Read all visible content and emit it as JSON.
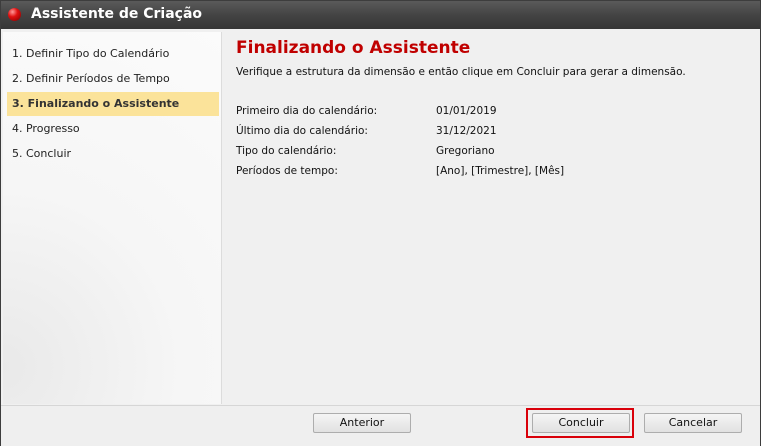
{
  "window": {
    "title": "Assistente de Criação"
  },
  "sidebar": {
    "steps": [
      {
        "label": "1. Definir Tipo do Calendário"
      },
      {
        "label": "2. Definir Períodos de Tempo"
      },
      {
        "label": "3. Finalizando o Assistente",
        "active": true
      },
      {
        "label": "4. Progresso"
      },
      {
        "label": "5. Concluir"
      }
    ]
  },
  "main": {
    "heading": "Finalizando o Assistente",
    "subtitle": "Verifique a estrutura da dimensão e então clique em Concluir para gerar a dimensão.",
    "summary": [
      {
        "label": "Primeiro dia do calendário:",
        "value": "01/01/2019"
      },
      {
        "label": "Último dia do calendário:",
        "value": "31/12/2021"
      },
      {
        "label": "Tipo do calendário:",
        "value": "Gregoriano"
      },
      {
        "label": "Períodos de tempo:",
        "value": "[Ano], [Trimestre], [Mês]"
      }
    ]
  },
  "footer": {
    "back_label": "Anterior",
    "finish_label": "Concluir",
    "cancel_label": "Cancelar"
  },
  "colors": {
    "heading": "#c00000",
    "active_step": "#fbe39a",
    "highlight_border": "#d9000a",
    "titlebar": "#444444"
  }
}
